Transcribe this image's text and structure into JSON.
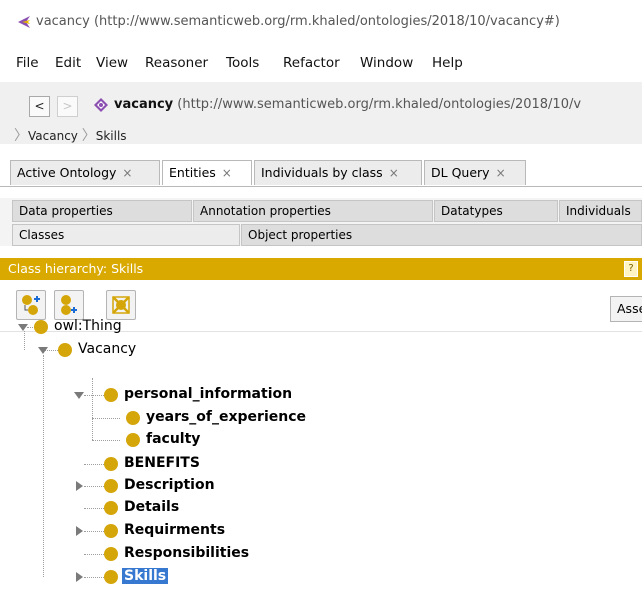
{
  "window": {
    "title": "vacancy (http://www.semanticweb.org/rm.khaled/ontologies/2018/10/vacancy#)"
  },
  "menu": [
    "File",
    "Edit",
    "View",
    "Reasoner",
    "Tools",
    "Refactor",
    "Window",
    "Help"
  ],
  "address": {
    "back_label": "<",
    "forward_label": ">",
    "name": "vacancy",
    "iri": " (http://www.semanticweb.org/rm.khaled/ontologies/2018/10/v",
    "breadcrumb": [
      "Vacancy",
      "Skills"
    ]
  },
  "tabs": [
    {
      "label": "Active Ontology",
      "close": "×"
    },
    {
      "label": "Entities",
      "close": "×",
      "active": true
    },
    {
      "label": "Individuals by class",
      "close": "×"
    },
    {
      "label": "DL Query",
      "close": "×"
    }
  ],
  "entity_tabs_row1": [
    "Data properties",
    "Annotation properties",
    "Datatypes",
    "Individuals"
  ],
  "entity_tabs_row2": [
    "Classes",
    "Object properties"
  ],
  "hierarchy": {
    "title": "Class hierarchy: Skills",
    "ctrl_label": "?",
    "asserted_label": "Asserted"
  },
  "tree": {
    "root": "owl:Thing",
    "level1": "Vacancy",
    "personal_information": "personal_information",
    "years_of_experience": "years_of_experience",
    "faculty": "faculty",
    "benefits": "BENEFITS",
    "description": "Description",
    "details": "Details",
    "requirements": "Requirments",
    "responsibilities": "Responsibilities",
    "skills": "Skills"
  },
  "colors": {
    "accent": "#d9a900",
    "class_disc": "#d5a60a",
    "selection": "#3778d0"
  }
}
